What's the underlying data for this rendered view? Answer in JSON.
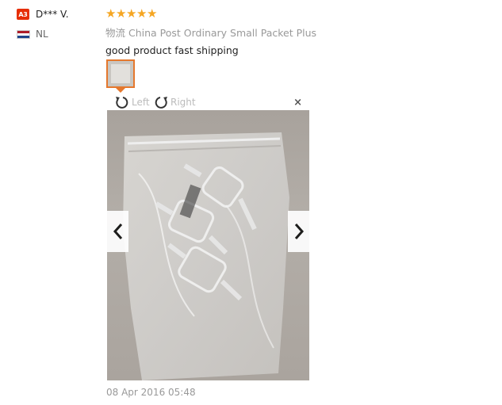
{
  "user": {
    "level_badge": "A3",
    "name": "D*** V.",
    "country": "NL"
  },
  "review": {
    "rating": 5,
    "shipping": "物流 China Post Ordinary Small Packet Plus",
    "comment": "good product fast shipping",
    "date": "08 Apr 2016 05:48"
  },
  "viewer": {
    "rotate_left_label": "Left",
    "rotate_right_label": "Right",
    "close_label": "×"
  },
  "colors": {
    "star": "#f5a623",
    "badge": "#e62e04",
    "thumb_border": "#e5782d"
  },
  "icons": [
    "star-icon",
    "rotate-left-icon",
    "rotate-right-icon",
    "close-icon",
    "chevron-left-icon",
    "chevron-right-icon",
    "flag-nl-icon"
  ]
}
